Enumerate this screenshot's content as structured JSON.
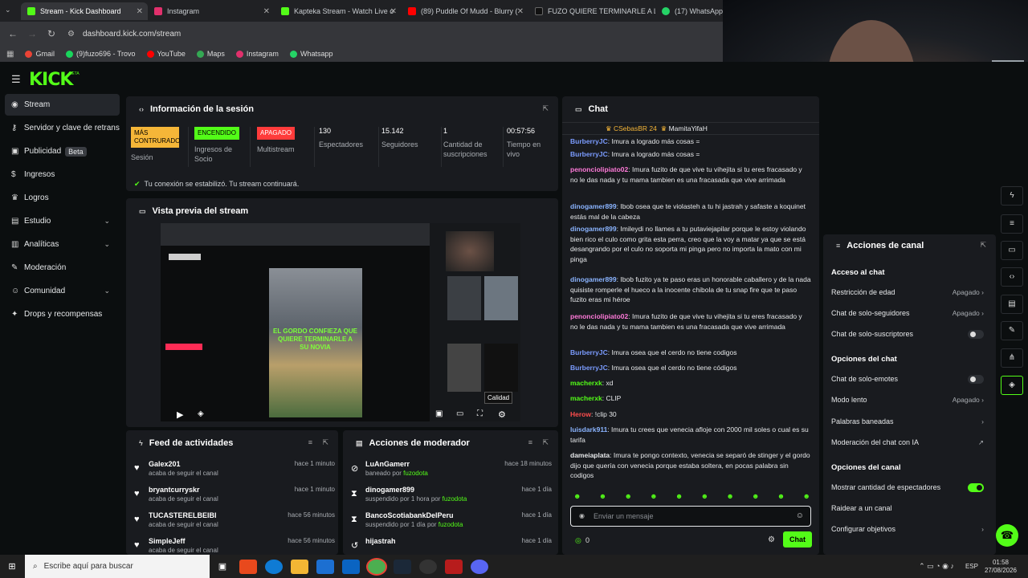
{
  "browser": {
    "tabs": [
      {
        "label": "Stream - Kick Dashboard",
        "color": "#53fc18"
      },
      {
        "label": "Instagram",
        "color": "#e1306c"
      },
      {
        "label": "Kapteka Stream - Watch Live o",
        "color": "#53fc18"
      },
      {
        "label": "(89) Puddle Of Mudd - Blurry (",
        "color": "#ff0000"
      },
      {
        "label": "FUZO QUIERE TERMINARLE A L",
        "color": "#111111"
      },
      {
        "label": "(17) WhatsApp",
        "color": "#25d366"
      }
    ],
    "url": "dashboard.kick.com/stream",
    "bookmarks": [
      {
        "label": "Gmail",
        "color": "#ea4335"
      },
      {
        "label": "(9)fuzo696 - Trovo",
        "color": "#19d65c"
      },
      {
        "label": "YouTube",
        "color": "#ff0000"
      },
      {
        "label": "Maps",
        "color": "#34a853"
      },
      {
        "label": "Instagram",
        "color": "#e1306c"
      },
      {
        "label": "Whatsapp",
        "color": "#25d366"
      }
    ]
  },
  "logo": "KICK",
  "logo_tag": "BETA",
  "sidebar": {
    "items": [
      {
        "label": "Stream",
        "icon": "broadcast-icon"
      },
      {
        "label": "Servidor y clave de retransmisión",
        "icon": "key-icon"
      },
      {
        "label": "Publicidad",
        "icon": "ad-icon",
        "badge": "Beta"
      },
      {
        "label": "Ingresos",
        "icon": "money-icon"
      },
      {
        "label": "Logros",
        "icon": "trophy-icon"
      },
      {
        "label": "Estudio",
        "icon": "studio-icon"
      },
      {
        "label": "Analíticas",
        "icon": "chart-icon"
      },
      {
        "label": "Moderación",
        "icon": "wrench-icon"
      },
      {
        "label": "Comunidad",
        "icon": "community-icon"
      },
      {
        "label": "Drops y recompensas",
        "icon": "gift-icon"
      }
    ]
  },
  "session": {
    "title": "Información de la sesión",
    "stats": [
      {
        "value": "MÁS CONTRURADO",
        "label": "Sesión",
        "color": "#f5b638"
      },
      {
        "value": "ENCENDIDO",
        "label": "Ingresos de Socio",
        "color": "#53fc18"
      },
      {
        "value": "APAGADO",
        "label": "Multistream",
        "color": "#ff3b3b"
      },
      {
        "value": "130",
        "label": "Espectadores"
      },
      {
        "value": "15.142",
        "label": "Seguidores"
      },
      {
        "value": "1",
        "label": "Cantidad de suscripciones"
      },
      {
        "value": "00:57:56",
        "label": "Tiempo en vivo"
      }
    ],
    "notice": "Tu conexión se estabilizó. Tu stream continuará."
  },
  "preview": {
    "title": "Vista previa del stream",
    "overlay_text": "EL GORDO CONFIEZA QUE QUIERE TERMINARLE A SU NOVIA",
    "quality_label": "Calidad"
  },
  "feed": {
    "title": "Feed de actividades",
    "rows": [
      {
        "name": "Galex201",
        "desc": "acaba de seguir el canal",
        "time": "hace 1 minuto"
      },
      {
        "name": "bryantcurryskr",
        "desc": "acaba de seguir el canal",
        "time": "hace 1 minuto"
      },
      {
        "name": "TUCASTERELBEIBI",
        "desc": "acaba de seguir el canal",
        "time": "hace 56 minutos"
      },
      {
        "name": "SimpleJeff",
        "desc": "acaba de seguir el canal",
        "time": "hace 56 minutos"
      }
    ]
  },
  "modactions": {
    "title": "Acciones de moderador",
    "rows": [
      {
        "name": "LuAnGamerr",
        "desc": "baneado por",
        "by": "fuzodota",
        "time": "hace 18 minutos",
        "icon": "ban-icon"
      },
      {
        "name": "dinogamer899",
        "desc": "suspendido por 1 hora por",
        "by": "fuzodota",
        "time": "hace 1 día",
        "icon": "hourglass-icon"
      },
      {
        "name": "BancoScotiabankDelPeru",
        "desc": "suspendido por 1 día por",
        "by": "fuzodota",
        "time": "hace 1 día",
        "icon": "hourglass-icon"
      },
      {
        "name": "hijastrah",
        "desc": "",
        "by": "",
        "time": "hace 1 día",
        "icon": "undo-icon"
      }
    ]
  },
  "chat": {
    "title": "Chat",
    "pinned": [
      "CSebasBR 24",
      "MamitaYifaH"
    ],
    "messages": [
      {
        "user": "BurberryJC",
        "color": "#7b9cff",
        "text": "Imura a logrado más cosas ="
      },
      {
        "user": "BurberryJC",
        "color": "#7b9cff",
        "text": "Imura a logrado más cosas ="
      },
      {
        "user": "penonciolipiato02",
        "color": "#ff7ad9",
        "text": "Imura fuzito de que vive tu vihejita si tu eres fracasado y no le das nada y tu mama tambien es una fracasada que vive arrimada"
      },
      {
        "user": "dinogamer899",
        "color": "#8ab4ff",
        "text": "Ibob osea que te violasteh a tu hi jastrah y safaste a koquinet estás mal de la cabeza"
      },
      {
        "user": "dinogamer899",
        "color": "#8ab4ff",
        "text": "Imileydi no llames a tu putaviejapilar porque le estoy violando bien rico el culo como grita esta perra, creo que la voy a matar ya que se está desangrando por el culo no soporta mi pinga pero no importa la mato con mi pinga"
      },
      {
        "user": "dinogamer899",
        "color": "#8ab4ff",
        "text": "Ibob fuzito ya te paso eras un honorable caballero y de la nada quisiste romperle el hueco a la inocente chibola de tu snap fire que te paso fuzito eras mi héroe"
      },
      {
        "user": "penonciolipiato02",
        "color": "#ff7ad9",
        "text": "Imura fuzito de que vive tu vihejita si tu eres fracasado y no le das nada y tu mama tambien es una fracasada que vive arrimada"
      },
      {
        "user": "BurberryJC",
        "color": "#7b9cff",
        "text": "Imura osea que el cerdo no tiene codigos"
      },
      {
        "user": "BurberryJC",
        "color": "#7b9cff",
        "text": "Imura osea que el cerdo no tiene códigos"
      },
      {
        "user": "macherxk",
        "color": "#53fc18",
        "text": "xd"
      },
      {
        "user": "macherxk",
        "color": "#53fc18",
        "text": "CLIP"
      },
      {
        "user": "Herow",
        "color": "#ff4d4d",
        "text": "!clip 30"
      },
      {
        "user": "luisdark911",
        "color": "#8ab4ff",
        "text": "Imura tu crees que venecia afloje con 2000 mil soles o cual es su tarifa"
      },
      {
        "user": "dameiaplata",
        "color": "#e6e8ea",
        "text": "Imura te pongo contexto, venecia se separó de stinger y el gordo dijo que quería con venecia porque estaba soltera, en pocas palabra sin codigos"
      }
    ],
    "input_placeholder": "Enviar un mensaje",
    "points": "0",
    "send_label": "Chat"
  },
  "channel": {
    "title": "Acciones de canal",
    "sections": [
      {
        "title": "Acceso al chat",
        "rows": [
          {
            "label": "Restricción de edad",
            "value": "Apagado",
            "type": "select"
          },
          {
            "label": "Chat de solo-seguidores",
            "value": "Apagado",
            "type": "select"
          },
          {
            "label": "Chat de solo-suscriptores",
            "value": "",
            "type": "toggle-off"
          }
        ]
      },
      {
        "title": "Opciones del chat",
        "rows": [
          {
            "label": "Chat de solo-emotes",
            "value": "",
            "type": "toggle-off"
          },
          {
            "label": "Modo lento",
            "value": "Apagado",
            "type": "select"
          },
          {
            "label": "Palabras baneadas",
            "value": "",
            "type": "link"
          },
          {
            "label": "Moderación del chat con IA",
            "value": "",
            "type": "external"
          }
        ]
      },
      {
        "title": "Opciones del canal",
        "rows": [
          {
            "label": "Mostrar cantidad de espectadores",
            "value": "",
            "type": "toggle-on"
          },
          {
            "label": "Raidear a un canal",
            "value": "",
            "type": "none"
          },
          {
            "label": "Configurar objetivos",
            "value": "",
            "type": "link"
          }
        ]
      }
    ]
  },
  "taskbar": {
    "search_placeholder": "Escribe aquí para buscar",
    "time": "01:58",
    "date": "27/08/2026",
    "lang": "ESP"
  }
}
